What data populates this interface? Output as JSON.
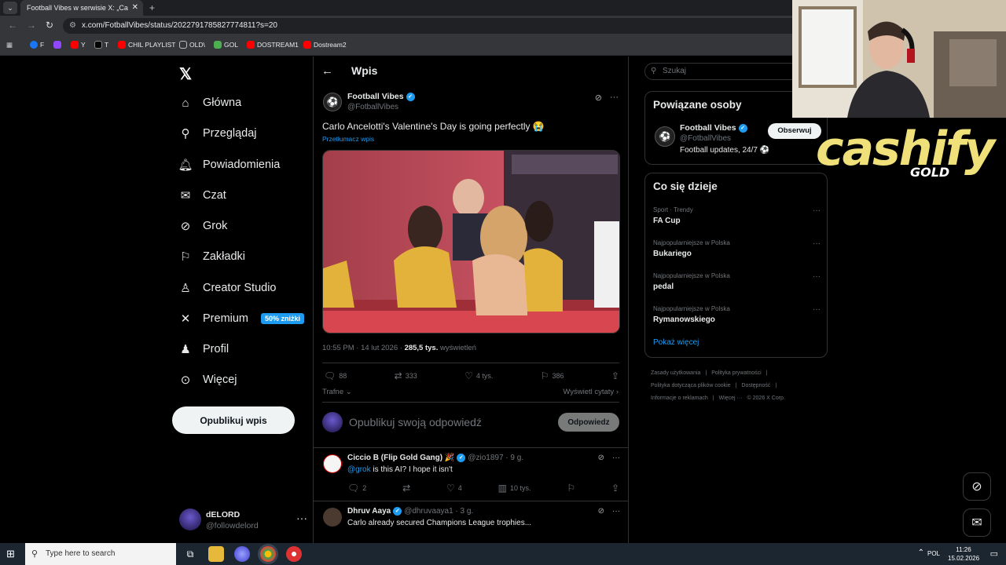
{
  "browser": {
    "tab_title": "Football Vibes w serwisie X: „Ca",
    "tab_close": "✕",
    "tab_new": "+",
    "url": "x.com/FotballVibes/status/2022791785827774811?s=20",
    "bookmarks": [
      {
        "label": "F",
        "color": "#1877f2"
      },
      {
        "label": "",
        "color": "#9146ff"
      },
      {
        "label": "Y",
        "color": "#ff0000"
      },
      {
        "label": "T",
        "color": "#000000"
      },
      {
        "label": "CHIL PLAYLIST",
        "color": "#ff0000"
      },
      {
        "label": "OLD\\",
        "color": "#888888"
      },
      {
        "label": "GOL",
        "color": "#4caf50"
      },
      {
        "label": "DOSTREAM1",
        "color": "#ff0000"
      },
      {
        "label": "Dostream2",
        "color": "#ff0000"
      }
    ]
  },
  "nav": {
    "items": [
      {
        "label": "Główna",
        "icon": "home-icon"
      },
      {
        "label": "Przeglądaj",
        "icon": "search-icon"
      },
      {
        "label": "Powiadomienia",
        "icon": "bell-icon"
      },
      {
        "label": "Czat",
        "icon": "mail-icon"
      },
      {
        "label": "Grok",
        "icon": "grok-icon"
      },
      {
        "label": "Zakładki",
        "icon": "bookmark-icon"
      },
      {
        "label": "Creator Studio",
        "icon": "creator-icon"
      },
      {
        "label": "Premium",
        "icon": "x-icon"
      },
      {
        "label": "Profil",
        "icon": "user-icon"
      },
      {
        "label": "Więcej",
        "icon": "more-icon"
      }
    ],
    "premium_badge": "50% zniżki",
    "post_button": "Opublikuj wpis",
    "profile": {
      "name": "dELORD",
      "handle": "@followdelord"
    }
  },
  "post": {
    "header": "Wpis",
    "author": "Football Vibes",
    "handle": "@FotballVibes",
    "text": "Carlo Ancelotti's Valentine's Day is going perfectly 😭",
    "translate": "Przetłumacz wpis",
    "time": "10:55 PM · 14 lut 2026 · ",
    "views": "285,5 tys.",
    "views_label": " wyświetleń",
    "stats": {
      "replies": "88",
      "reposts": "333",
      "likes": "4 tys.",
      "bookmarks": "386"
    },
    "sort_label": "Trafne",
    "quotes_label": "Wyświetl cytaty",
    "reply_placeholder": "Opublikuj swoją odpowiedź",
    "reply_button": "Odpowiedz"
  },
  "comments": [
    {
      "name": "Ciccio B (Flip Gold Gang) 🎉",
      "handle": "@zio1897 · 9 g.",
      "mention": "@grok",
      "text": " is this AI? I hope it isn't",
      "replies": "2",
      "reposts": "",
      "likes": "4",
      "views": "10 tys."
    },
    {
      "name": "Dhruv Aaya",
      "handle": "@dhruvaaya1 · 3 g.",
      "mention": "",
      "text": "Carlo already secured Champions League trophies...",
      "replies": "",
      "reposts": "",
      "likes": "",
      "views": ""
    }
  ],
  "sidebar": {
    "search_placeholder": "Szukaj",
    "related_title": "Powiązane osoby",
    "related": {
      "name": "Football Vibes",
      "handle": "@FotballVibes",
      "bio": "Football updates, 24/7 ⚽",
      "follow": "Obserwuj"
    },
    "trends_title": "Co się dzieje",
    "trends": [
      {
        "category": "Sport · Trendy",
        "name": "FA Cup"
      },
      {
        "category": "Najpopularniejsze w Polska",
        "name": "Bukariego"
      },
      {
        "category": "Najpopularniejsze w Polska",
        "name": "pedal"
      },
      {
        "category": "Najpopularniejsze w Polska",
        "name": "Rymanowskiego"
      }
    ],
    "show_more": "Pokaż więcej",
    "footer": [
      "Zasady użytkowania",
      "|",
      "Polityka prywatności",
      "|",
      "Polityka dotycząca plików cookie",
      "|",
      "Dostępność",
      "|",
      "Informacje o reklamach",
      "|",
      "Więcej ···",
      "© 2026 X Corp."
    ]
  },
  "overlay": {
    "brand": "cashify",
    "sub": "GOLD"
  },
  "taskbar": {
    "search_placeholder": "Type here to search",
    "lang": "POL",
    "time": "11:26",
    "date": "15.02.2026"
  }
}
